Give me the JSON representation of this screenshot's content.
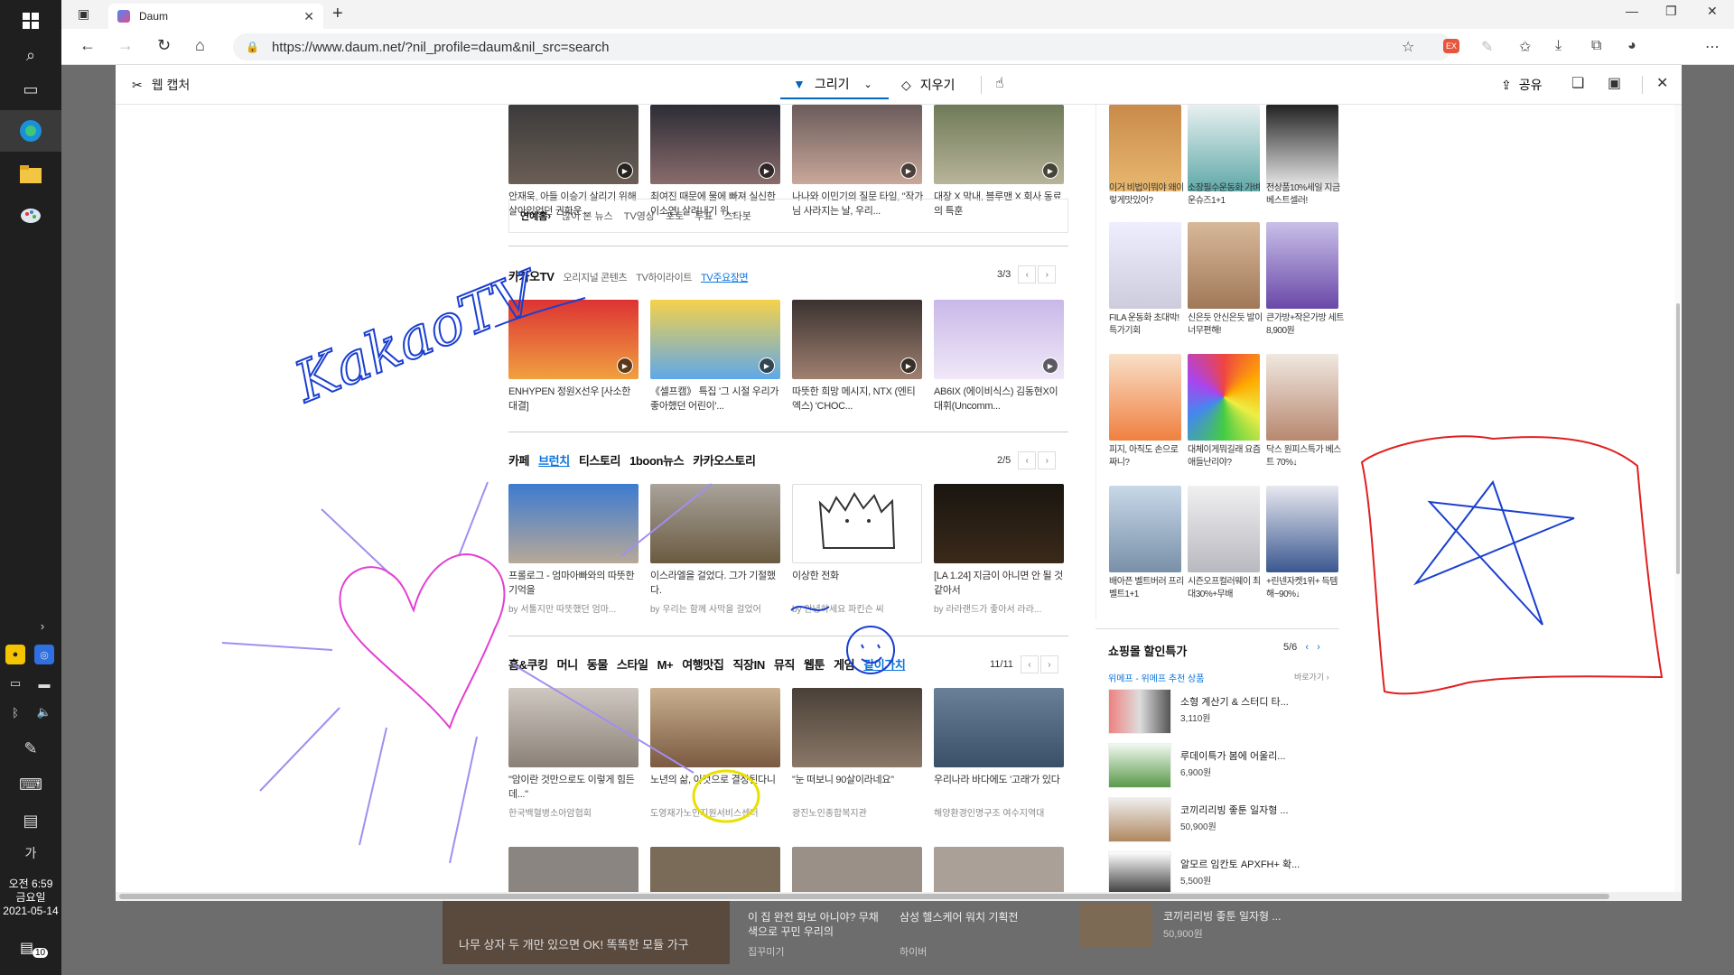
{
  "taskbar": {
    "clock_time": "오전 6:59",
    "clock_day": "금요일",
    "clock_date": "2021-05-14",
    "notification_count": "10",
    "ime_label": "가"
  },
  "browser": {
    "tab_title": "Daum",
    "url": "https://www.daum.net/?nil_profile=daum&nil_src=search"
  },
  "capture": {
    "title": "웹 캡처",
    "draw_label": "그리기",
    "erase_label": "지우기",
    "share_label": "공유"
  },
  "entertainment": {
    "videos": [
      {
        "caption": "안재욱, 아들 이승기 살리기 위해 살아있었던 권화운..."
      },
      {
        "caption": "최여진 때문에 물에 빠져 실신한 이소연! 살려내기 위..."
      },
      {
        "caption": "나나와 이민기의 질문 타임, \"작가님 사라지는 날, 우리..."
      },
      {
        "caption": "대장 X 막내, 블루맨 X 회사 동료의 특훈"
      }
    ],
    "links": [
      "연예홈›",
      "많이 본 뉴스",
      "TV영상",
      "포토",
      "투표",
      "스타봇"
    ]
  },
  "kakaotv": {
    "title": "카카오TV",
    "tabs": [
      "오리지널 콘텐츠",
      "TV하이라이트",
      "TV주요장면"
    ],
    "pager": "3/3",
    "videos": [
      {
        "caption": "ENHYPEN 정원X선우 [사소한 대결]"
      },
      {
        "caption": "《셀프캠》 특집 '그 시절 우리가 좋아했던 어린이'..."
      },
      {
        "caption": "따뜻한 희망 메시지, NTX (엔티엑스) 'CHOC..."
      },
      {
        "caption": "AB6IX (에이비식스) 김동현X이대휘(Uncomm..."
      }
    ]
  },
  "cafe": {
    "tabs": [
      "카페",
      "브런치",
      "티스토리",
      "1boon뉴스",
      "카카오스토리"
    ],
    "pager": "2/5",
    "items": [
      {
        "caption": "프롤로그 - 엄마아빠와의 따뜻한 기억을",
        "source": "by 서툴지만 따뜻했던 엄마..."
      },
      {
        "caption": "이스라엘을 걸었다. 그가 기절했다.",
        "source": "by 우리는 함께 사막을 걸었어"
      },
      {
        "caption": "이상한 전화",
        "source": "by 안녕하세요 파킨슨 씨"
      },
      {
        "caption": "[LA 1.24] 지금이 아니면 안 될 것 같아서",
        "source": "by 라라랜드가 좋아서 라라..."
      }
    ]
  },
  "topics": {
    "tabs": [
      "홈&쿠킹",
      "머니",
      "동물",
      "스타일",
      "M+",
      "여행맛집",
      "직장IN",
      "뮤직",
      "웹툰",
      "게임",
      "같이가치"
    ],
    "pager": "11/11",
    "items": [
      {
        "caption": "\"암이란 것만으로도 이렇게 힘든데...\"",
        "source": "한국백혈병소아암협회"
      },
      {
        "caption": "노년의 삶, 이것으로 결정된다니",
        "source": "도영재가노인지원서비스센터"
      },
      {
        "caption": "\"눈 떠보니 90살이라네요\"",
        "source": "광진노인종합복지관"
      },
      {
        "caption": "우리나라 바다에도 '고래'가 있다",
        "source": "해양환경인명구조 여수지역대"
      }
    ]
  },
  "shopping": {
    "items": [
      {
        "caption": "이거 비법이뭐야 왜이렇게맛있어?"
      },
      {
        "caption": "소장필수운동화 가벼운슈즈1+1"
      },
      {
        "caption": "전상품10%세일 지금베스트셀러!"
      },
      {
        "caption": "FILA 운동화 초대박!특가기회"
      },
      {
        "caption": "신은듯 안신은듯 발이 너무편해!"
      },
      {
        "caption": "큰가방+작은가방 세트8,900원"
      },
      {
        "caption": "피지, 아직도 손으로 짜니?"
      },
      {
        "caption": "대체이게뭐길래 요즘애들난리야?"
      },
      {
        "caption": "닥스 원피스특가 베스트 70%↓"
      },
      {
        "caption": "배아픈 벨트버러 프리벨트1+1"
      },
      {
        "caption": "시즌오프컬러웨이 최대30%+무배"
      },
      {
        "caption": "+린넨자켓1위+ 득템해~90%↓"
      }
    ],
    "deal_title": "쇼핑몰 할인특가",
    "deal_pager": "5/6",
    "deal_sub": "위메프 - 위메프 추천 상품",
    "deal_more": "바로가기 ›",
    "deals": [
      {
        "name": "소형 계산기 & 스터디 타...",
        "price": "3,110원"
      },
      {
        "name": "루데이특가 봄에 어울리...",
        "price": "6,900원"
      },
      {
        "name": "코끼리리빙 좋툰 일자형 ...",
        "price": "50,900원"
      },
      {
        "name": "알모르 임칸토 APXFH+ 확...",
        "price": "5,500원"
      }
    ]
  },
  "background": {
    "headline": "나무 상자 두 개만 있으면 OK! 똑똑한 모듈 가구",
    "items": [
      {
        "caption": "이 집 완전 화보 아니야? 무채색으로 꾸민 우리의",
        "source": "집꾸미기"
      },
      {
        "caption": "삼성 헬스케어 워치 기획전",
        "source": "하이버"
      },
      {
        "caption": "코끼리리빙 좋툰 일자형 ...",
        "source": "50,900원"
      }
    ]
  },
  "ink": {
    "kakao_text": "KakaoTV"
  }
}
